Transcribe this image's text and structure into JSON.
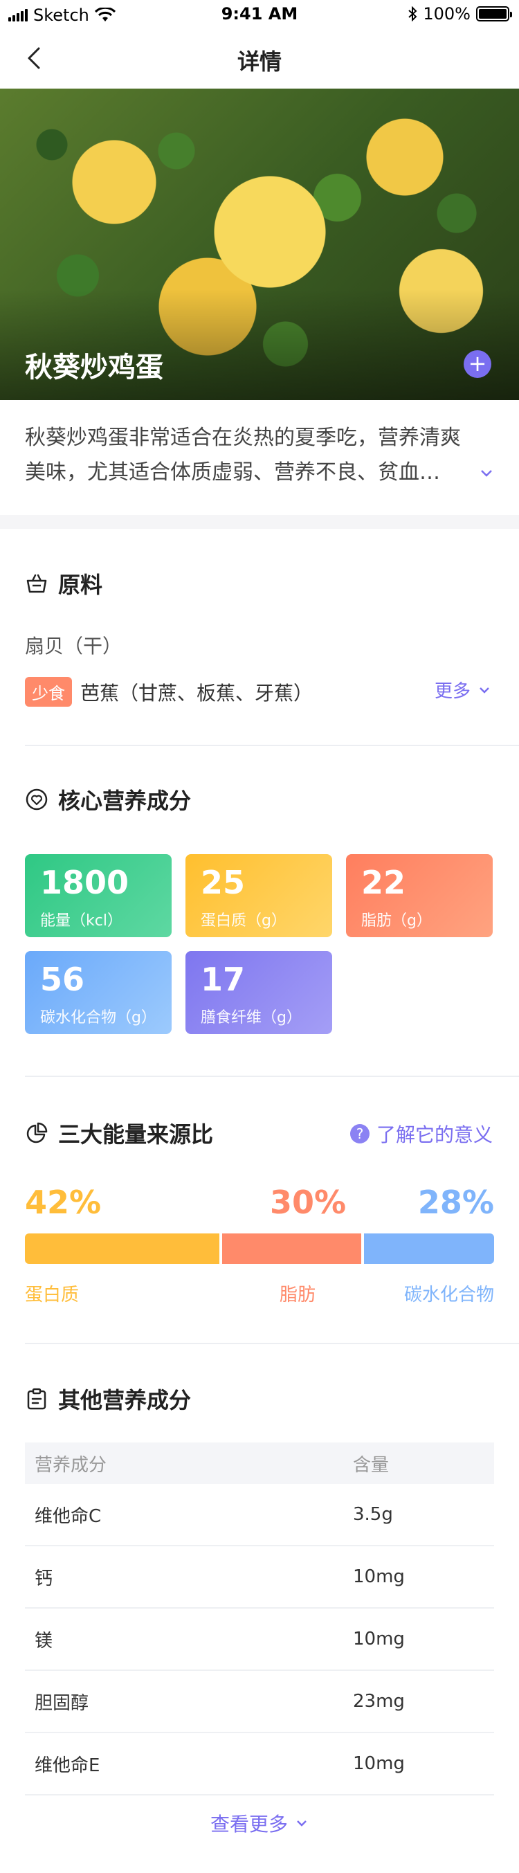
{
  "status_bar": {
    "carrier": "Sketch",
    "time": "9:41 AM",
    "battery": "100%"
  },
  "nav": {
    "title": "详情"
  },
  "hero": {
    "dish_name": "秋葵炒鸡蛋"
  },
  "description": {
    "line1": "秋葵炒鸡蛋非常适合在炎热的夏季吃，营养清爽",
    "line2": "美味，尤其适合体质虚弱、营养不良、贫血…"
  },
  "ingredients": {
    "title": "原料",
    "item1": "扇贝（干）",
    "item2_tag": "少食",
    "item2": "芭蕉（甘蔗、板蕉、牙蕉）",
    "more_label": "更多"
  },
  "core_nutrition": {
    "title": "核心营养成分",
    "cards": [
      {
        "value": "1800",
        "label": "能量（kcl）",
        "color": "#3ccf8e"
      },
      {
        "value": "25",
        "label": "蛋白质（g）",
        "color": "#ffc33a"
      },
      {
        "value": "22",
        "label": "脂肪（g）",
        "color": "#ff8a6a"
      },
      {
        "value": "56",
        "label": "碳水化合物（g）",
        "color": "#7fb4fb"
      },
      {
        "value": "17",
        "label": "膳食纤维（g）",
        "color": "#8c84f2"
      }
    ]
  },
  "energy_sources": {
    "title": "三大能量来源比",
    "help_label": "了解它的意义",
    "segments": [
      {
        "label": "蛋白质",
        "percent": 42,
        "percent_text": "42%",
        "color": "#ffbd3a"
      },
      {
        "label": "脂肪",
        "percent": 30,
        "percent_text": "30%",
        "color": "#ff8a6a"
      },
      {
        "label": "碳水化合物",
        "percent": 28,
        "percent_text": "28%",
        "color": "#7fb4fb"
      }
    ]
  },
  "other_nutrition": {
    "title": "其他营养成分",
    "headers": [
      "营养成分",
      "含量"
    ],
    "rows": [
      [
        "维他命C",
        "3.5g"
      ],
      [
        "钙",
        "10mg"
      ],
      [
        "镁",
        "10mg"
      ],
      [
        "胆固醇",
        "23mg"
      ],
      [
        "维他命E",
        "10mg"
      ]
    ],
    "view_more": "查看更多"
  },
  "accent_color": "#7a6ef0"
}
